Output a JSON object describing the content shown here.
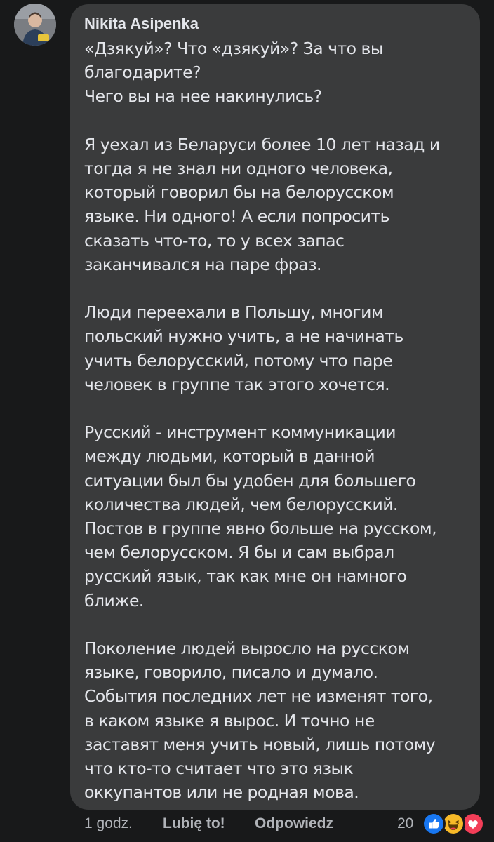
{
  "comment": {
    "author": "Nikita Asipenka",
    "paragraphs": [
      {
        "lines": [
          "«Дзякуй»? Что «дзякуй»? За что вы",
          "благодарите?",
          "Чего вы на нее накинулись?"
        ]
      },
      {
        "lines": [
          "Я уехал из Беларуси более 10 лет назад и",
          "тогда я не знал ни одного человека,",
          "который говорил бы на белорусском",
          "языке. Ни одного! А если попросить",
          "сказать что-то, то у всех запас",
          "заканчивался на паре фраз."
        ]
      },
      {
        "lines": [
          "Люди переехали в Польшу, многим",
          "польский нужно учить, а не начинать",
          "учить белорусский, потому что паре",
          "человек в группе так этого хочется."
        ]
      },
      {
        "lines": [
          "Русский - инструмент коммуникации",
          "между людьми, который в данной",
          "ситуации был бы удобен для большего",
          "количества людей, чем белорусский.",
          "Постов в группе явно больше на русском,",
          "чем белорусском. Я бы и сам выбрал",
          "русский язык, так как мне он намного",
          "ближе."
        ]
      },
      {
        "lines": [
          "Поколение людей выросло на русском",
          "языке, говорило, писало и думало.",
          "События последних лет не изменят того,",
          "в каком языке я вырос. И точно не",
          "заставят меня учить новый, лишь потому",
          "что кто-то считает что это язык",
          "оккупантов или не родная мова."
        ]
      }
    ]
  },
  "actions": {
    "time": "1 godz.",
    "like": "Lubię to!",
    "reply": "Odpowiedz",
    "reaction_count": "20",
    "reactions": [
      "like-reaction-icon",
      "haha-reaction-icon",
      "love-reaction-icon"
    ]
  },
  "colors": {
    "background": "#18191a",
    "bubble": "#3a3b3c",
    "text": "#e4e6eb",
    "muted": "#b0b3b8",
    "like_blue": "#1877f2",
    "haha_yellow": "#f7b928",
    "love_red": "#f33e58"
  }
}
